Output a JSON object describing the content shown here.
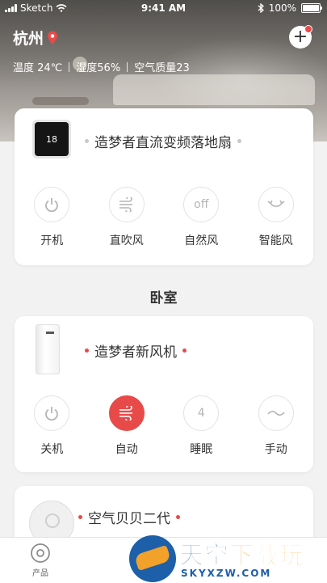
{
  "status_bar": {
    "carrier": "Sketch",
    "time": "9:41 AM",
    "battery": "100%"
  },
  "header": {
    "city": "杭州",
    "temperature": "温度 24℃",
    "humidity": "湿度56%",
    "air_quality": "空气质量23"
  },
  "devices": [
    {
      "name": "造梦者直流变频落地扇",
      "display_value": "18",
      "controls": [
        {
          "label": "开机",
          "icon": "power-icon",
          "active": false
        },
        {
          "label": "直吹风",
          "icon": "wind-icon",
          "active": false
        },
        {
          "label": "自然风",
          "icon": "off-text-icon",
          "icon_text": "off",
          "active": false
        },
        {
          "label": "智能风",
          "icon": "cycle-arrow-icon",
          "active": false
        }
      ]
    },
    {
      "name": "造梦者新风机",
      "controls": [
        {
          "label": "关机",
          "icon": "power-icon",
          "active": false
        },
        {
          "label": "自动",
          "icon": "wind-icon",
          "active": true
        },
        {
          "label": "睡眠",
          "icon": "number-icon",
          "icon_text": "4",
          "active": false
        },
        {
          "label": "手动",
          "icon": "wave-icon",
          "active": false
        }
      ]
    },
    {
      "name": "空气贝贝二代"
    }
  ],
  "room_title": "卧室",
  "tabbar": {
    "product_label": "产品"
  },
  "watermark": {
    "title_a": "天空",
    "title_b": "下载玩",
    "url": "SKYXZW.COM"
  },
  "colors": {
    "accent": "#e84a4a",
    "background": "#f2f2f2",
    "card": "#ffffff",
    "watermark_blue": "#1d5fa8",
    "watermark_orange": "#f2a12b"
  }
}
